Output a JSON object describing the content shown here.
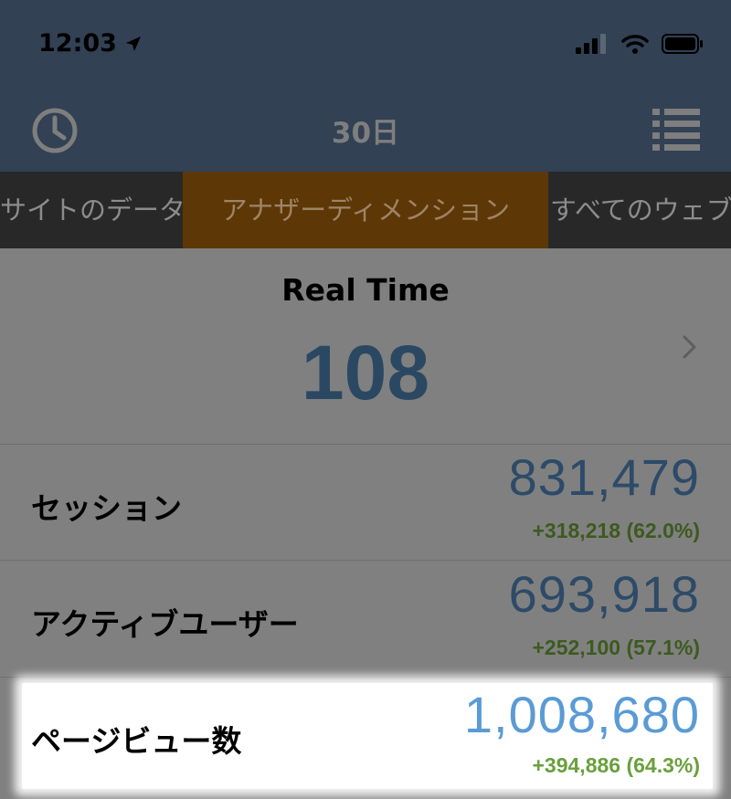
{
  "status_bar": {
    "time": "12:03",
    "location_icon": "location-arrow-icon",
    "signal_icon": "cellular-signal-icon",
    "wifi_icon": "wifi-icon",
    "battery_icon": "battery-icon"
  },
  "nav": {
    "title": "30日",
    "left_icon": "clock-icon",
    "right_icon": "list-menu-icon"
  },
  "tabs": [
    {
      "label": "サイトのデータ",
      "active": false
    },
    {
      "label": "アナザーディメンション",
      "active": true
    },
    {
      "label": "すべてのウェブ",
      "active": false
    }
  ],
  "realtime": {
    "title": "Real Time",
    "value": "108"
  },
  "metrics": [
    {
      "label": "セッション",
      "value": "831,479",
      "change": "+318,218 (62.0%)"
    },
    {
      "label": "アクティブユーザー",
      "value": "693,918",
      "change": "+252,100 (57.1%)"
    },
    {
      "label": "ページビュー数",
      "value": "1,008,680",
      "change": "+394,886 (64.3%)",
      "highlighted": true
    }
  ],
  "colors": {
    "header_bg": "#324154",
    "tab_active_bg": "#5e3707",
    "value_blue": "#2d4b68",
    "change_green": "#3d5a1f"
  }
}
